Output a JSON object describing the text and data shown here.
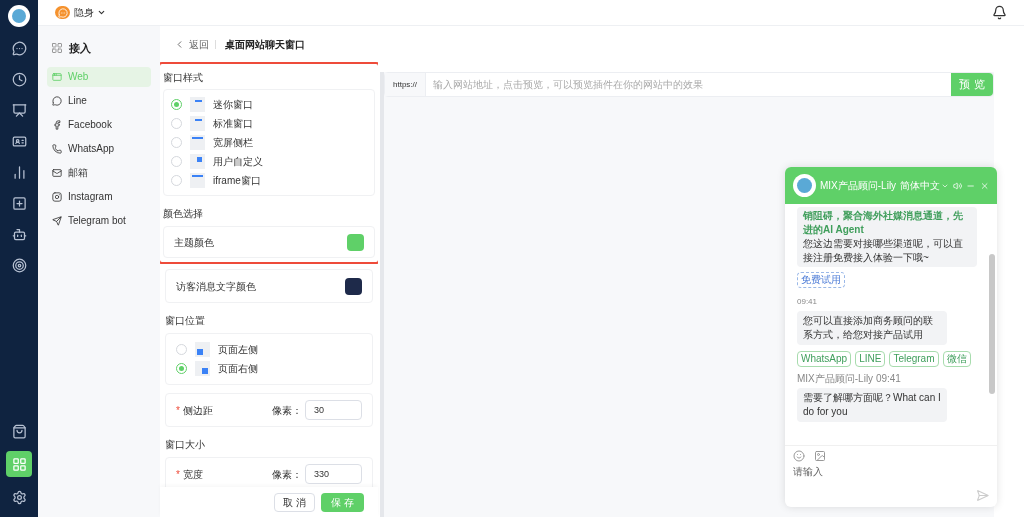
{
  "rail": {
    "items": [
      {
        "kind": "chat",
        "selected": false
      },
      {
        "kind": "history",
        "selected": false
      },
      {
        "kind": "board",
        "selected": false
      },
      {
        "kind": "contact",
        "selected": false
      },
      {
        "kind": "stats",
        "selected": false
      },
      {
        "kind": "add",
        "selected": false
      },
      {
        "kind": "ai",
        "selected": false
      },
      {
        "kind": "target",
        "selected": false
      }
    ],
    "bottom": [
      {
        "kind": "bag",
        "selected": false
      },
      {
        "kind": "apps",
        "selected": true
      },
      {
        "kind": "settings",
        "selected": false
      }
    ]
  },
  "topbar": {
    "status": "隐身"
  },
  "sidebar": {
    "title": "接入",
    "items": [
      {
        "label": "Web",
        "kind": "web",
        "selected": true
      },
      {
        "label": "Line",
        "kind": "line",
        "selected": false
      },
      {
        "label": "Facebook",
        "kind": "facebook",
        "selected": false
      },
      {
        "label": "WhatsApp",
        "kind": "whatsapp",
        "selected": false
      },
      {
        "label": "邮箱",
        "kind": "mail",
        "selected": false
      },
      {
        "label": "Instagram",
        "kind": "instagram",
        "selected": false
      },
      {
        "label": "Telegram bot",
        "kind": "telegram",
        "selected": false
      }
    ]
  },
  "header": {
    "back": "返回",
    "title": "桌面网站聊天窗口"
  },
  "form": {
    "style_title": "窗口样式",
    "styles": [
      {
        "label": "迷你窗口",
        "kind": "mini",
        "selected": true
      },
      {
        "label": "标准窗口",
        "kind": "standard",
        "selected": false
      },
      {
        "label": "宽屏侧栏",
        "kind": "wide",
        "selected": false
      },
      {
        "label": "用户自定义",
        "kind": "custom",
        "selected": false
      },
      {
        "label": "iframe窗口",
        "kind": "iframe",
        "selected": false
      }
    ],
    "color_title": "颜色选择",
    "theme_color": {
      "label": "主题颜色",
      "color": "#5fd068"
    },
    "visitor_color": {
      "label": "访客消息文字颜色",
      "color": "#1e2a4a"
    },
    "position_title": "窗口位置",
    "positions": [
      {
        "label": "页面左侧",
        "kind": "left",
        "selected": false
      },
      {
        "label": "页面右侧",
        "kind": "right",
        "selected": true
      }
    ],
    "margin": {
      "required_mark": "*",
      "label": "侧边距",
      "unit": "像素：",
      "value": "30"
    },
    "size_title": "窗口大小",
    "width": {
      "required_mark": "*",
      "label": "宽度",
      "unit": "像素：",
      "value": "330"
    },
    "buttons": {
      "cancel": "取 消",
      "save": "保 存"
    }
  },
  "preview": {
    "prefix": "https://",
    "placeholder": "输入网站地址，点击预览，可以预览插件在你的网站中的效果",
    "button": "预 览"
  },
  "chat": {
    "agent": "MIX产品顾问-Lily",
    "language": "简体中文",
    "greeting_highlight": "销阻碍，聚合海外社媒消息通道，先进的AI Agent",
    "greeting": "您这边需要对接哪些渠道呢，可以直接注册免费接入体验一下哦~",
    "trial": "免费试用",
    "time1": "09:41",
    "message1": "您可以直接添加商务顾问的联系方式，给您对接产品试用",
    "channels": [
      "WhatsApp",
      "LINE",
      "Telegram",
      "微信"
    ],
    "sender": "MIX产品顾问-Lily 09:41",
    "message2": "需要了解哪方面呢？What can I do for you",
    "input_placeholder": "请输入"
  }
}
